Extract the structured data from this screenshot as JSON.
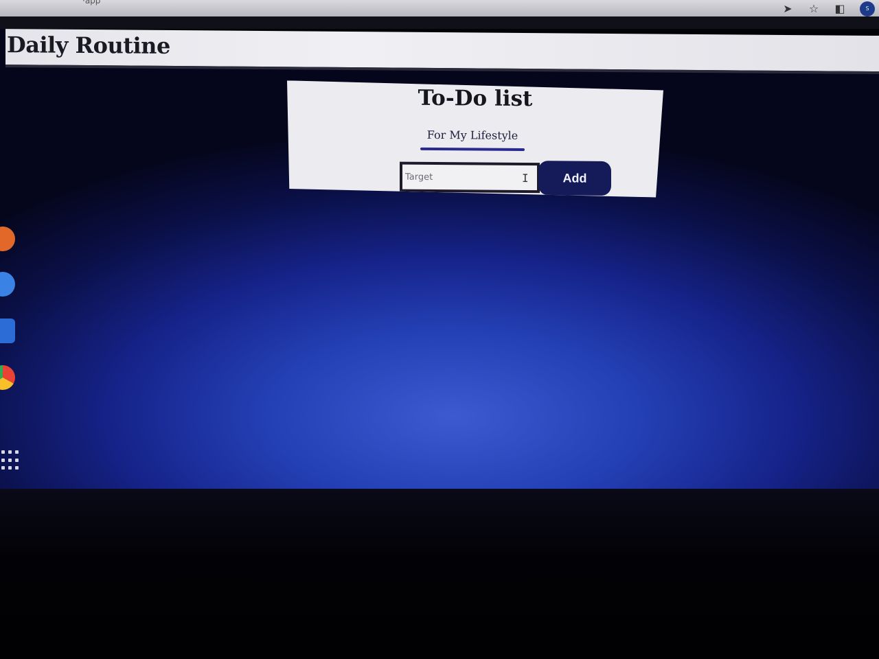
{
  "browser": {
    "url_fragment": "·app",
    "icons": [
      "send-icon",
      "star-icon",
      "sidebar-icon",
      "profile-avatar"
    ],
    "profile_initial": "S"
  },
  "header": {
    "title": "Daily Routine"
  },
  "todo": {
    "title": "To-Do list",
    "subtitle": "For My Lifestyle",
    "input_placeholder": "Target",
    "add_label": "Add"
  },
  "dock": {
    "apps": [
      "orange-app-icon",
      "blue-app-icon",
      "docs-app-icon",
      "chrome-icon",
      "app-launcher-icon"
    ]
  },
  "colors": {
    "accent": "#151a58",
    "underline": "#2a2a8e",
    "card_background": "#ececf0",
    "screen_gradient_center": "#3d5ad0",
    "screen_gradient_edge": "#05061c"
  }
}
